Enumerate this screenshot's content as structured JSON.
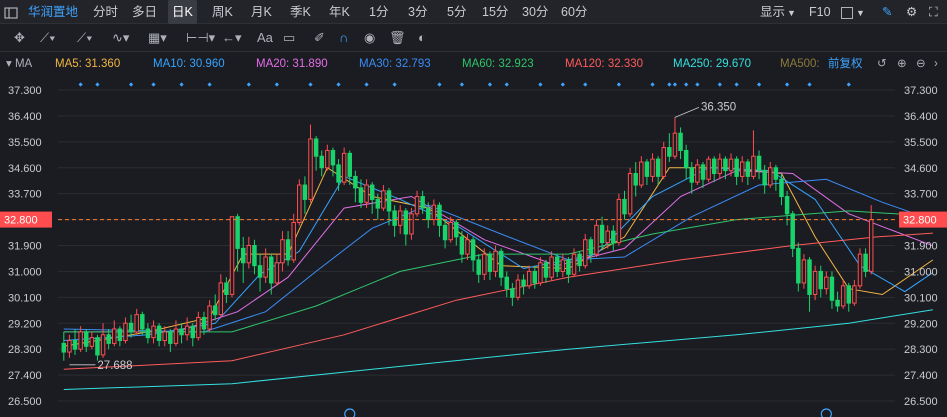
{
  "header": {
    "stock_name": "华润置地",
    "periods": [
      "分时",
      "多日",
      "日K",
      "周K",
      "月K",
      "季K",
      "年K",
      "1分",
      "3分",
      "5分",
      "15分",
      "30分",
      "60分"
    ],
    "active_period": "日K",
    "display_label": "显示",
    "f10_label": "F10"
  },
  "ma_bar": {
    "toggle_label": "MA",
    "items": [
      {
        "label": "MA5: 31.360",
        "color": "#f2b544"
      },
      {
        "label": "MA10: 30.960",
        "color": "#35a3ff"
      },
      {
        "label": "MA20: 31.890",
        "color": "#e46ee8"
      },
      {
        "label": "MA30: 32.793",
        "color": "#3a8cf5"
      },
      {
        "label": "MA60: 32.923",
        "color": "#2fc46b"
      },
      {
        "label": "MA120: 32.330",
        "color": "#ff5b5b"
      },
      {
        "label": "MA250: 29.670",
        "color": "#33e0e0"
      },
      {
        "label": "MA500:",
        "color": "#8a7a3c"
      }
    ],
    "adjust_label": "前复权"
  },
  "chart_data": {
    "type": "candlestick",
    "y_ticks": [
      "37.300",
      "36.400",
      "35.500",
      "34.600",
      "33.700",
      "32.800",
      "31.900",
      "31.000",
      "30.100",
      "29.200",
      "28.300",
      "27.400",
      "26.500"
    ],
    "ylim": [
      26.5,
      37.3
    ],
    "current_price": 32.8,
    "current_price_label": "32.800",
    "high_annotation": "36.350",
    "low_annotation": "27.688",
    "up_color": "#ff4d4f",
    "down_color": "#19d36b",
    "candles": [
      [
        28.5,
        28.2,
        28.9,
        27.9
      ],
      [
        28.2,
        28.6,
        28.8,
        28.0
      ],
      [
        28.6,
        28.3,
        29.0,
        28.1
      ],
      [
        28.3,
        28.9,
        29.1,
        28.2
      ],
      [
        28.9,
        28.4,
        29.0,
        28.2
      ],
      [
        28.4,
        28.7,
        28.9,
        28.3
      ],
      [
        28.7,
        28.1,
        28.8,
        27.9
      ],
      [
        28.1,
        28.8,
        29.2,
        28.0
      ],
      [
        28.8,
        28.5,
        29.0,
        28.3
      ],
      [
        28.5,
        29.0,
        29.3,
        28.4
      ],
      [
        29.0,
        28.6,
        29.1,
        28.4
      ],
      [
        28.6,
        29.2,
        29.4,
        28.5
      ],
      [
        29.2,
        28.9,
        29.5,
        28.7
      ],
      [
        28.9,
        29.5,
        29.7,
        28.8
      ],
      [
        29.5,
        29.0,
        29.6,
        28.8
      ],
      [
        29.0,
        28.7,
        29.2,
        28.5
      ],
      [
        28.7,
        29.1,
        29.3,
        28.5
      ],
      [
        29.1,
        28.6,
        29.2,
        28.4
      ],
      [
        28.6,
        28.9,
        29.1,
        28.4
      ],
      [
        28.9,
        28.5,
        29.0,
        28.2
      ],
      [
        28.5,
        29.0,
        29.3,
        28.4
      ],
      [
        29.0,
        28.8,
        29.2,
        28.5
      ],
      [
        28.8,
        29.1,
        29.4,
        28.6
      ],
      [
        29.1,
        28.7,
        29.2,
        28.4
      ],
      [
        28.7,
        29.4,
        29.6,
        28.6
      ],
      [
        29.4,
        29.0,
        29.6,
        28.8
      ],
      [
        29.0,
        29.8,
        30.0,
        28.9
      ],
      [
        29.8,
        29.5,
        30.2,
        29.3
      ],
      [
        29.5,
        30.6,
        30.9,
        29.4
      ],
      [
        30.6,
        30.2,
        30.8,
        29.9
      ],
      [
        30.2,
        32.9,
        32.9,
        30.1
      ],
      [
        32.9,
        31.8,
        33.0,
        31.0
      ],
      [
        31.8,
        31.3,
        32.2,
        30.6
      ],
      [
        31.3,
        31.9,
        32.2,
        31.1
      ],
      [
        31.9,
        31.2,
        32.1,
        30.9
      ],
      [
        31.2,
        30.8,
        31.6,
        30.3
      ],
      [
        30.8,
        31.5,
        31.8,
        30.6
      ],
      [
        31.5,
        30.6,
        31.6,
        30.2
      ],
      [
        30.6,
        31.3,
        31.6,
        30.5
      ],
      [
        31.3,
        32.1,
        32.4,
        31.0
      ],
      [
        32.1,
        31.4,
        32.4,
        31.2
      ],
      [
        31.4,
        32.7,
        33.0,
        31.3
      ],
      [
        32.7,
        34.0,
        34.2,
        32.6
      ],
      [
        34.0,
        33.5,
        34.3,
        33.0
      ],
      [
        33.5,
        35.6,
        36.1,
        33.4
      ],
      [
        35.6,
        35.0,
        35.7,
        34.5
      ],
      [
        35.0,
        34.6,
        35.2,
        34.3
      ],
      [
        34.6,
        35.2,
        35.4,
        34.5
      ],
      [
        35.2,
        34.7,
        35.3,
        34.3
      ],
      [
        34.7,
        34.1,
        34.9,
        33.8
      ],
      [
        34.1,
        35.1,
        35.3,
        34.0
      ],
      [
        35.1,
        34.3,
        35.2,
        34.0
      ],
      [
        34.3,
        33.9,
        34.5,
        33.4
      ],
      [
        33.9,
        33.4,
        34.2,
        33.2
      ],
      [
        33.4,
        34.0,
        34.2,
        33.2
      ],
      [
        34.0,
        33.5,
        34.1,
        33.0
      ],
      [
        33.5,
        33.2,
        33.7,
        32.8
      ],
      [
        33.2,
        33.8,
        34.0,
        33.1
      ],
      [
        33.8,
        33.1,
        33.9,
        32.6
      ],
      [
        33.1,
        32.6,
        33.3,
        32.2
      ],
      [
        32.6,
        33.1,
        33.3,
        32.3
      ],
      [
        33.1,
        32.3,
        33.2,
        31.9
      ],
      [
        32.3,
        33.0,
        33.2,
        32.1
      ],
      [
        33.0,
        33.6,
        33.8,
        32.9
      ],
      [
        33.6,
        33.2,
        33.8,
        33.0
      ],
      [
        33.2,
        32.8,
        33.4,
        32.5
      ],
      [
        32.8,
        33.3,
        33.5,
        32.6
      ],
      [
        33.3,
        32.6,
        33.4,
        32.2
      ],
      [
        32.6,
        32.1,
        32.8,
        31.8
      ],
      [
        32.1,
        32.7,
        32.9,
        32.0
      ],
      [
        32.7,
        32.2,
        32.8,
        31.9
      ],
      [
        32.2,
        31.6,
        32.4,
        31.3
      ],
      [
        31.6,
        32.1,
        32.3,
        31.4
      ],
      [
        32.1,
        31.4,
        32.2,
        31.0
      ],
      [
        31.4,
        30.9,
        31.6,
        30.6
      ],
      [
        30.9,
        31.6,
        31.8,
        30.7
      ],
      [
        31.6,
        31.0,
        31.7,
        30.7
      ],
      [
        31.0,
        31.7,
        31.9,
        30.8
      ],
      [
        31.7,
        30.8,
        31.8,
        30.5
      ],
      [
        30.8,
        30.4,
        31.0,
        30.1
      ],
      [
        30.4,
        30.1,
        30.6,
        29.8
      ],
      [
        30.1,
        30.7,
        30.9,
        30.0
      ],
      [
        30.7,
        30.5,
        30.9,
        30.2
      ],
      [
        30.5,
        31.0,
        31.2,
        30.4
      ],
      [
        31.0,
        30.6,
        31.2,
        30.4
      ],
      [
        30.6,
        31.3,
        31.5,
        30.5
      ],
      [
        31.3,
        30.8,
        31.4,
        30.6
      ],
      [
        30.8,
        31.5,
        31.7,
        30.7
      ],
      [
        31.5,
        31.0,
        31.6,
        30.8
      ],
      [
        31.0,
        31.4,
        31.6,
        30.8
      ],
      [
        31.4,
        30.9,
        31.5,
        30.6
      ],
      [
        30.9,
        31.6,
        31.8,
        30.8
      ],
      [
        31.6,
        31.2,
        31.7,
        31.0
      ],
      [
        31.2,
        32.1,
        32.3,
        31.1
      ],
      [
        32.1,
        31.6,
        32.2,
        31.3
      ],
      [
        31.6,
        32.6,
        32.8,
        31.5
      ],
      [
        32.6,
        32.0,
        32.9,
        31.8
      ],
      [
        32.0,
        32.4,
        32.6,
        31.8
      ],
      [
        32.4,
        32.0,
        32.6,
        31.7
      ],
      [
        32.0,
        33.5,
        33.7,
        31.9
      ],
      [
        33.5,
        33.0,
        33.8,
        32.8
      ],
      [
        33.0,
        34.4,
        34.6,
        32.9
      ],
      [
        34.4,
        34.0,
        34.8,
        33.6
      ],
      [
        34.0,
        34.8,
        35.0,
        33.9
      ],
      [
        34.8,
        34.3,
        34.9,
        34.0
      ],
      [
        34.3,
        34.9,
        35.1,
        34.1
      ],
      [
        34.9,
        34.3,
        35.0,
        34.0
      ],
      [
        34.3,
        35.3,
        35.5,
        34.2
      ],
      [
        35.3,
        35.0,
        35.8,
        34.8
      ],
      [
        35.0,
        35.8,
        36.35,
        34.9
      ],
      [
        35.8,
        35.2,
        36.0,
        34.9
      ],
      [
        35.2,
        34.6,
        35.4,
        34.2
      ],
      [
        34.6,
        34.1,
        34.8,
        33.7
      ],
      [
        34.1,
        34.7,
        34.9,
        34.0
      ],
      [
        34.7,
        34.2,
        34.8,
        33.9
      ],
      [
        34.2,
        34.9,
        35.0,
        34.1
      ],
      [
        34.9,
        34.4,
        35.0,
        34.1
      ],
      [
        34.4,
        34.9,
        35.1,
        34.2
      ],
      [
        34.9,
        34.5,
        35.0,
        34.2
      ],
      [
        34.5,
        34.9,
        35.1,
        34.3
      ],
      [
        34.9,
        34.3,
        35.0,
        34.0
      ],
      [
        34.3,
        34.8,
        35.0,
        34.1
      ],
      [
        34.8,
        34.3,
        34.9,
        34.0
      ],
      [
        34.3,
        35.0,
        35.9,
        34.2
      ],
      [
        35.0,
        34.5,
        35.2,
        34.2
      ],
      [
        34.5,
        34.0,
        34.7,
        33.7
      ],
      [
        34.0,
        34.6,
        34.8,
        33.9
      ],
      [
        34.6,
        34.2,
        34.7,
        33.8
      ],
      [
        34.2,
        33.6,
        34.4,
        33.3
      ],
      [
        33.6,
        33.0,
        33.8,
        32.6
      ],
      [
        33.0,
        31.8,
        33.1,
        31.5
      ],
      [
        31.8,
        30.6,
        32.0,
        30.3
      ],
      [
        30.6,
        31.4,
        31.6,
        30.4
      ],
      [
        31.4,
        30.2,
        31.5,
        29.6
      ],
      [
        30.2,
        31.0,
        31.2,
        30.0
      ],
      [
        31.0,
        30.4,
        31.2,
        30.1
      ],
      [
        30.4,
        30.8,
        31.0,
        30.2
      ],
      [
        30.8,
        30.0,
        31.0,
        29.7
      ],
      [
        30.0,
        29.8,
        30.3,
        29.6
      ],
      [
        29.8,
        30.5,
        30.7,
        29.7
      ],
      [
        30.5,
        29.9,
        30.6,
        29.6
      ],
      [
        29.9,
        30.5,
        30.7,
        29.8
      ],
      [
        30.5,
        31.6,
        31.8,
        30.4
      ],
      [
        31.6,
        31.0,
        31.8,
        30.8
      ],
      [
        31.0,
        32.8,
        33.3,
        30.9
      ]
    ],
    "ma_lines": [
      {
        "name": "MA5",
        "color": "#f2b544",
        "values": [
          [
            0,
            28.4
          ],
          [
            15,
            28.9
          ],
          [
            26,
            29.4
          ],
          [
            32,
            31.6
          ],
          [
            40,
            31.6
          ],
          [
            47,
            34.6
          ],
          [
            55,
            33.6
          ],
          [
            65,
            33.2
          ],
          [
            78,
            31.2
          ],
          [
            90,
            31.1
          ],
          [
            100,
            32.2
          ],
          [
            108,
            34.6
          ],
          [
            118,
            34.6
          ],
          [
            128,
            34.4
          ],
          [
            134,
            32.2
          ],
          [
            140,
            30.4
          ],
          [
            146,
            30.2
          ],
          [
            155,
            31.4
          ]
        ]
      },
      {
        "name": "MA10",
        "color": "#35a3ff",
        "values": [
          [
            0,
            28.6
          ],
          [
            15,
            28.8
          ],
          [
            27,
            29.2
          ],
          [
            35,
            30.9
          ],
          [
            42,
            31.7
          ],
          [
            50,
            34.3
          ],
          [
            60,
            33.5
          ],
          [
            70,
            32.6
          ],
          [
            82,
            31.1
          ],
          [
            95,
            31.6
          ],
          [
            105,
            33.6
          ],
          [
            115,
            34.6
          ],
          [
            126,
            34.5
          ],
          [
            134,
            33.5
          ],
          [
            142,
            31.2
          ],
          [
            150,
            30.3
          ],
          [
            155,
            30.96
          ]
        ]
      },
      {
        "name": "MA20",
        "color": "#e46ee8",
        "values": [
          [
            0,
            28.9
          ],
          [
            20,
            28.9
          ],
          [
            31,
            29.6
          ],
          [
            40,
            30.8
          ],
          [
            50,
            33.2
          ],
          [
            62,
            33.6
          ],
          [
            75,
            32.1
          ],
          [
            88,
            31.2
          ],
          [
            100,
            31.8
          ],
          [
            110,
            33.6
          ],
          [
            120,
            34.5
          ],
          [
            130,
            34.4
          ],
          [
            140,
            33.0
          ],
          [
            155,
            31.89
          ]
        ]
      },
      {
        "name": "MA30",
        "color": "#3a8cf5",
        "values": [
          [
            0,
            29.0
          ],
          [
            25,
            28.9
          ],
          [
            36,
            29.6
          ],
          [
            45,
            31.0
          ],
          [
            55,
            32.5
          ],
          [
            65,
            33.3
          ],
          [
            78,
            32.3
          ],
          [
            90,
            31.4
          ],
          [
            100,
            31.5
          ],
          [
            112,
            32.9
          ],
          [
            124,
            34.0
          ],
          [
            136,
            34.2
          ],
          [
            146,
            33.4
          ],
          [
            155,
            32.79
          ]
        ]
      },
      {
        "name": "MA60",
        "color": "#2fc46b",
        "values": [
          [
            0,
            28.9
          ],
          [
            30,
            28.9
          ],
          [
            45,
            29.8
          ],
          [
            60,
            31.0
          ],
          [
            75,
            31.6
          ],
          [
            90,
            31.6
          ],
          [
            105,
            32.3
          ],
          [
            120,
            32.8
          ],
          [
            140,
            33.1
          ],
          [
            155,
            32.92
          ]
        ]
      },
      {
        "name": "MA120",
        "color": "#ff5b5b",
        "values": [
          [
            0,
            27.6
          ],
          [
            30,
            27.9
          ],
          [
            50,
            28.8
          ],
          [
            70,
            30.0
          ],
          [
            90,
            30.8
          ],
          [
            110,
            31.4
          ],
          [
            130,
            31.9
          ],
          [
            145,
            32.2
          ],
          [
            155,
            32.33
          ]
        ]
      },
      {
        "name": "MA250",
        "color": "#33e0e0",
        "values": [
          [
            0,
            26.9
          ],
          [
            30,
            27.1
          ],
          [
            60,
            27.7
          ],
          [
            90,
            28.3
          ],
          [
            120,
            28.8
          ],
          [
            140,
            29.2
          ],
          [
            155,
            29.67
          ]
        ]
      }
    ]
  }
}
